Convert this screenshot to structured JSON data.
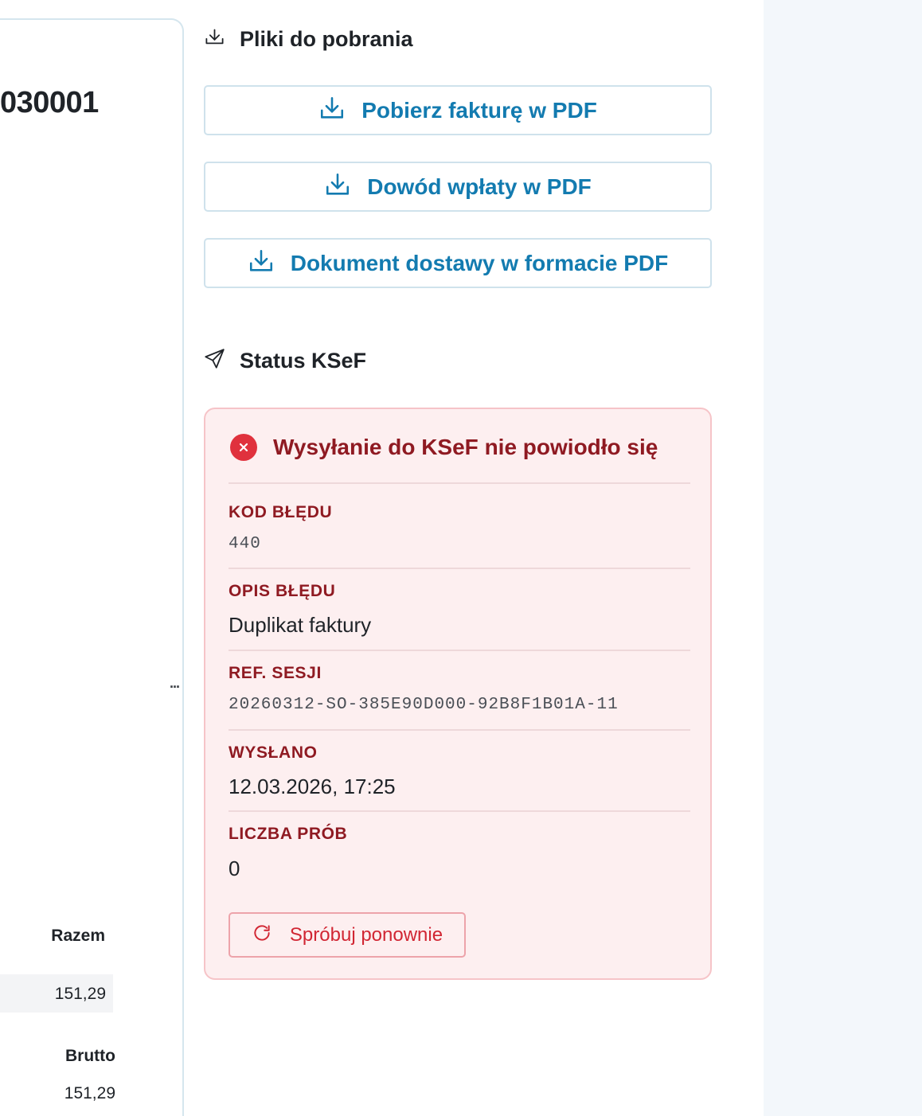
{
  "invoice": {
    "number_fragment": "030001",
    "ellipsis": "...",
    "summary": {
      "total_header": "Razem",
      "total_value": "151,29",
      "gross_header": "Brutto",
      "gross_value": "151,29"
    }
  },
  "downloads": {
    "title": "Pliki do pobrania",
    "icon": "download-icon",
    "buttons": [
      {
        "label": "Pobierz fakturę w PDF",
        "icon": "download-icon"
      },
      {
        "label": "Dowód wpłaty w PDF",
        "icon": "download-icon"
      },
      {
        "label": "Dokument dostawy w formacie PDF",
        "icon": "download-icon"
      }
    ]
  },
  "ksef": {
    "title": "Status KSeF",
    "icon": "send-icon",
    "error": {
      "title": "Wysyłanie do KSeF nie powiodło się",
      "icon": "error-x-icon",
      "fields": {
        "code_label": "KOD BŁĘDU",
        "code_value": "440",
        "desc_label": "OPIS BŁĘDU",
        "desc_value": "Duplikat faktury",
        "ref_label": "REF. SESJI",
        "ref_value": "20260312-SO-385E90D000-92B8F1B01A-11",
        "sent_label": "WYSŁANO",
        "sent_value": "12.03.2026, 17:25",
        "attempts_label": "LICZBA PRÓB",
        "attempts_value": "0"
      },
      "retry_label": "Spróbuj ponownie",
      "retry_icon": "refresh-icon"
    }
  },
  "colors": {
    "accent_blue": "#137bb0",
    "error_dark": "#8f1a22",
    "error_red": "#e0313d",
    "error_bg": "#fdeff0",
    "error_border": "#f6c4c8",
    "strip_bg": "#f3f7fb"
  }
}
